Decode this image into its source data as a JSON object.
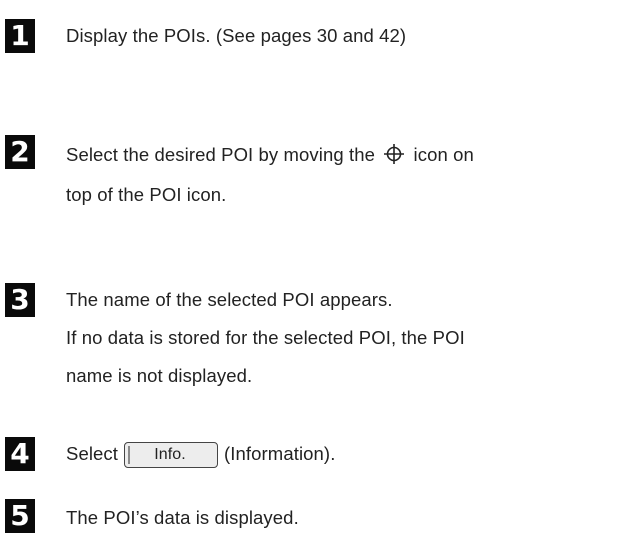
{
  "steps": [
    {
      "number": "1",
      "lines": [
        "Display the POIs. (See pages 30 and 42)"
      ]
    },
    {
      "number": "2",
      "line1_before": "Select the desired POI by moving the",
      "icon": "crosshair-icon",
      "line1_after": "icon on",
      "line2": "top of the POI icon."
    },
    {
      "number": "3",
      "lines": [
        "The name of the selected POI appears.",
        "If no data is stored for the selected POI, the POI",
        "name is not displayed."
      ]
    },
    {
      "number": "4",
      "before": "Select",
      "button_label": "Info.",
      "after": "(Information)."
    },
    {
      "number": "5",
      "lines": [
        "The POI’s data is displayed."
      ]
    }
  ]
}
